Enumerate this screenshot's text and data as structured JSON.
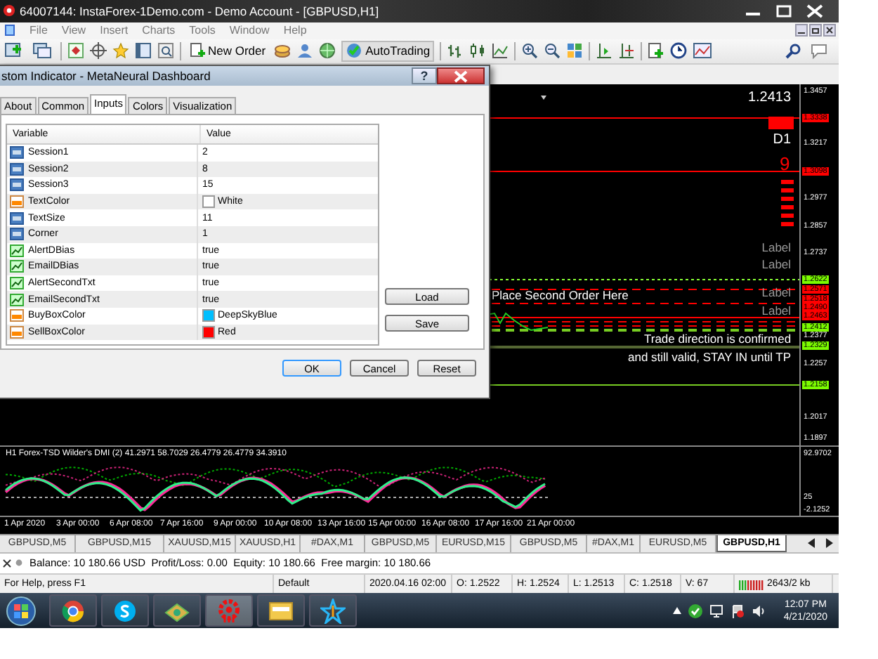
{
  "window": {
    "title": "64007144: InstaForex-1Demo.com - Demo Account - [GBPUSD,H1]"
  },
  "menu": [
    "File",
    "View",
    "Insert",
    "Charts",
    "Tools",
    "Window",
    "Help"
  ],
  "toolbar": {
    "new_order": "New Order",
    "autotrading": "AutoTrading"
  },
  "dialog": {
    "title": "stom Indicator - MetaNeural Dashboard",
    "help": "?",
    "tabs": [
      {
        "label": "About",
        "selected": false
      },
      {
        "label": "Common",
        "selected": false
      },
      {
        "label": "Inputs",
        "selected": true
      },
      {
        "label": "Colors",
        "selected": false
      },
      {
        "label": "Visualization",
        "selected": false
      }
    ],
    "columns": [
      "Variable",
      "Value"
    ],
    "rows": [
      {
        "kind": "int",
        "name": "Session1",
        "value": "2"
      },
      {
        "kind": "int",
        "name": "Session2",
        "value": "8"
      },
      {
        "kind": "int",
        "name": "Session3",
        "value": "15"
      },
      {
        "kind": "color",
        "name": "TextColor",
        "value": "White",
        "color": "#ffffff"
      },
      {
        "kind": "int",
        "name": "TextSize",
        "value": "11"
      },
      {
        "kind": "int",
        "name": "Corner",
        "value": "1"
      },
      {
        "kind": "bool",
        "name": "AlertDBias",
        "value": "true"
      },
      {
        "kind": "bool",
        "name": "EmailDBias",
        "value": "true"
      },
      {
        "kind": "bool",
        "name": "AlertSecondTxt",
        "value": "true"
      },
      {
        "kind": "bool",
        "name": "EmailSecondTxt",
        "value": "true"
      },
      {
        "kind": "color",
        "name": "BuyBoxColor",
        "value": "DeepSkyBlue",
        "color": "#00bfff"
      },
      {
        "kind": "color",
        "name": "SellBoxColor",
        "value": "Red",
        "color": "#ff0000"
      }
    ],
    "side_buttons": [
      "Load",
      "Save"
    ],
    "buttons": [
      "OK",
      "Cancel",
      "Reset"
    ]
  },
  "chart": {
    "price_readout": "1.2413",
    "timeframe": "D1",
    "signal_digit": "9",
    "labels": [
      "Label",
      "Label",
      "Label",
      "Label"
    ],
    "order_note": "Place Second Order Here",
    "trade_note": [
      "Trade direction is confirmed",
      "and still valid, STAY IN until TP"
    ],
    "price_axis": [
      {
        "text": "1.3457"
      },
      {
        "text": "1.3338",
        "color": "#ff0000"
      },
      {
        "text": "1.3217"
      },
      {
        "text": "1.3098",
        "color": "#ff0000"
      },
      {
        "text": "1.2977"
      },
      {
        "text": "1.2857"
      },
      {
        "text": "1.2737"
      },
      {
        "text": "1.2622",
        "color": "#7cfc00"
      },
      {
        "text": "1.2571",
        "color": "#ff0000"
      },
      {
        "text": "1.2518",
        "color": "#ff0000"
      },
      {
        "text": "1.2490",
        "color": "#ff0000"
      },
      {
        "text": "1.2463",
        "color": "#ff0000"
      },
      {
        "text": "1.2412",
        "color": "#7cfc00"
      },
      {
        "text": "1.2377"
      },
      {
        "text": "1.2329",
        "color": "#7cfc00"
      },
      {
        "text": "1.2257"
      },
      {
        "text": "1.2158",
        "color": "#7cfc00"
      },
      {
        "text": "1.2017"
      },
      {
        "text": "1.1897"
      }
    ]
  },
  "indicator": {
    "title": "H1 Forex-TSD Wilder's DMI (2) 41.2971 58.7029 26.4779 26.4779 34.3910",
    "axis": [
      "92.9702",
      "25",
      "-2.1252"
    ]
  },
  "time_axis": [
    "1 Apr 2020",
    "3 Apr 00:00",
    "6 Apr 08:00",
    "7 Apr 16:00",
    "9 Apr 00:00",
    "10 Apr 08:00",
    "13 Apr 16:00",
    "15 Apr 00:00",
    "16 Apr 08:00",
    "17 Apr 16:00",
    "21 Apr 00:00"
  ],
  "chart_tabs": [
    {
      "label": "GBPUSD,M5",
      "selected": false
    },
    {
      "label": "GBPUSD,M15",
      "selected": false
    },
    {
      "label": "XAUUSD,M15",
      "selected": false
    },
    {
      "label": "XAUUSD,H1",
      "selected": false
    },
    {
      "label": "#DAX,M1",
      "selected": false
    },
    {
      "label": "GBPUSD,M5",
      "selected": false
    },
    {
      "label": "EURUSD,M15",
      "selected": false
    },
    {
      "label": "GBPUSD,M5",
      "selected": false
    },
    {
      "label": "#DAX,M1",
      "selected": false
    },
    {
      "label": "EURUSD,M5",
      "selected": false
    },
    {
      "label": "GBPUSD,H1",
      "selected": true
    }
  ],
  "account": "Balance: 10 180.66 USD  Profit/Loss: 0.00  Equity: 10 180.66  Free margin: 10 180.66",
  "status_bar": [
    "For Help, press F1",
    "Default",
    "2020.04.16 02:00",
    "O: 1.2522",
    "H: 1.2524",
    "L: 1.2513",
    "C: 1.2518",
    "V: 67",
    "2643/2 kb"
  ],
  "taskbar": {
    "time": "12:07 PM",
    "date": "4/21/2020"
  }
}
